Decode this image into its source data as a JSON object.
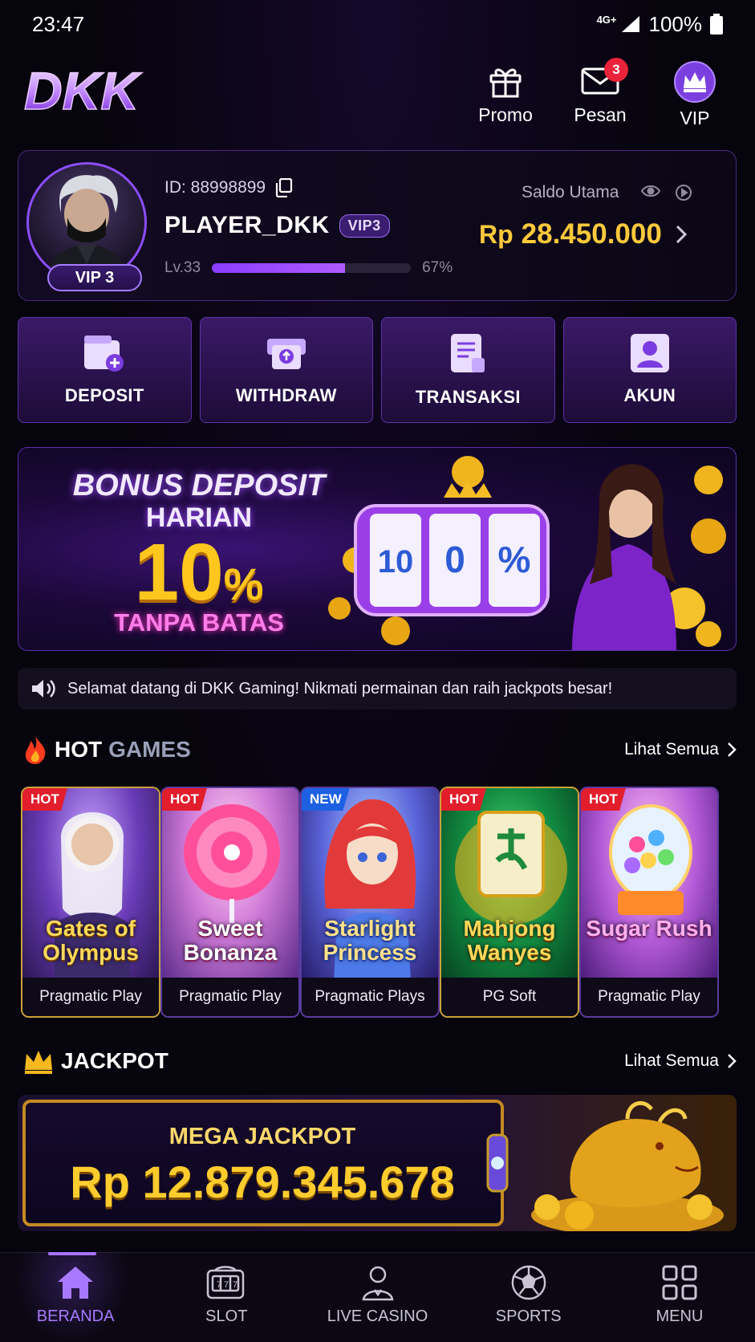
{
  "status": {
    "time": "23:47",
    "network": "4G+",
    "battery": "100%"
  },
  "header": {
    "logo": "DKK",
    "nav": [
      {
        "label": "Promo",
        "icon": "gift-icon"
      },
      {
        "label": "Pesan",
        "icon": "mail-icon",
        "badge": "3"
      },
      {
        "label": "VIP",
        "icon": "crown-icon"
      }
    ]
  },
  "profile": {
    "id_label": "ID: 88998899",
    "name": "PLAYER_DKK",
    "vip_tag": "VIP3",
    "avatar_vip": "VIP 3",
    "level": "Lv.33",
    "progress_percent": 67,
    "progress_label": "67%",
    "balance_label": "Saldo Utama",
    "currency": "Rp",
    "balance": "28.450.000"
  },
  "actions": [
    {
      "label": "DEPOSIT",
      "icon": "wallet-plus-icon"
    },
    {
      "label": "WITHDRAW",
      "icon": "withdraw-icon"
    },
    {
      "label": "TRANSAKSI",
      "icon": "receipt-icon"
    },
    {
      "label": "AKUN",
      "icon": "user-icon"
    }
  ],
  "banner": {
    "line1": "BONUS DEPOSIT",
    "line2": "HARIAN",
    "percent": "10",
    "percent_sign": "%",
    "line4": "TANPA BATAS",
    "reels": [
      "10",
      "0",
      "%"
    ]
  },
  "marquee": {
    "text": "Selamat datang di DKK Gaming! Nikmati permainan dan raih jackpots besar!"
  },
  "hot_games": {
    "title_a": "HOT",
    "title_b": "GAMES",
    "more": "Lihat Semua",
    "items": [
      {
        "tag": "HOT",
        "title": "Gates of Olympus",
        "provider": "Pragmatic Play"
      },
      {
        "tag": "HOT",
        "title": "Sweet Bonanza",
        "provider": "Pragmatic Play"
      },
      {
        "tag": "NEW",
        "title": "Starlight Princess",
        "provider": "Pragmatic Plays"
      },
      {
        "tag": "HOT",
        "title": "Mahjong Wanyes",
        "provider": "PG Soft"
      },
      {
        "tag": "HOT",
        "title": "Sugar Rush",
        "provider": "Pragmatic Play"
      }
    ]
  },
  "jackpot": {
    "title": "JACKPOT",
    "more": "Lihat Semua",
    "label": "MEGA JACKPOT",
    "value": "Rp 12.879.345.678"
  },
  "bottom_nav": [
    {
      "label": "BERANDA",
      "icon": "home-icon",
      "active": true
    },
    {
      "label": "SLOT",
      "icon": "slot-machine-icon"
    },
    {
      "label": "LIVE CASINO",
      "icon": "dealer-icon"
    },
    {
      "label": "SPORTS",
      "icon": "soccer-ball-icon"
    },
    {
      "label": "MENU",
      "icon": "grid-icon"
    }
  ]
}
